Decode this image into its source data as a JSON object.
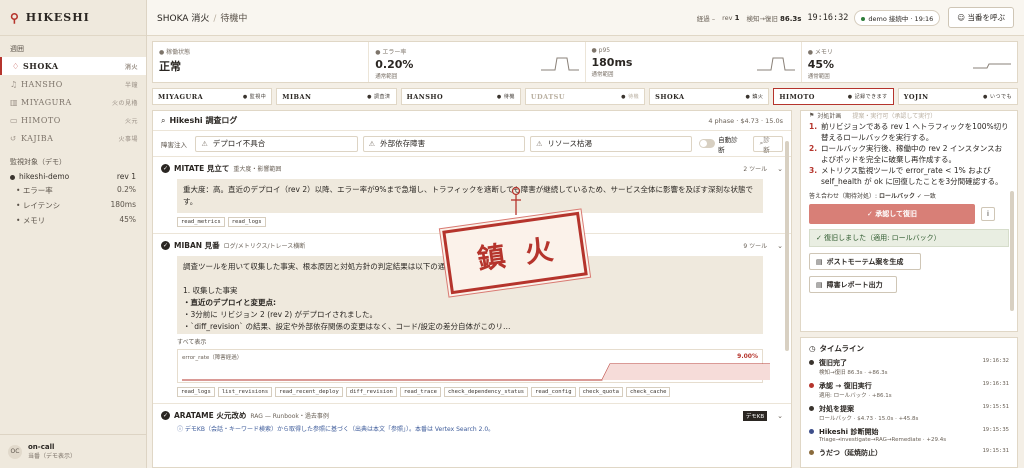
{
  "brand": {
    "name": "HIKESHI"
  },
  "sidebar": {
    "section_label": "週囲",
    "items": [
      {
        "name": "SHOKA",
        "tag": "消火"
      },
      {
        "name": "HANSHO",
        "tag": "半鐘"
      },
      {
        "name": "MIYAGURA",
        "tag": "火の見櫓"
      },
      {
        "name": "HIMOTO",
        "tag": "火元"
      },
      {
        "name": "KAJIBA",
        "tag": "火事場"
      }
    ],
    "monitor_label": "監視対象（デモ）",
    "monitor": {
      "name": "hikeshi-demo",
      "value": "rev 1"
    },
    "monitor_sub": [
      {
        "name": "エラー率",
        "value": "0.2%"
      },
      {
        "name": "レイテンシ",
        "value": "180ms"
      },
      {
        "name": "メモリ",
        "value": "45%"
      }
    ],
    "footer": {
      "avatar": "OC",
      "title": "on-call",
      "sub": "当番（デモ表示）"
    }
  },
  "topbar": {
    "crumb1": "SHOKA 消火",
    "sep": "/",
    "crumb2": "待機中",
    "elapsed_label": "経過 –",
    "rev_label": "rev",
    "rev": "1",
    "restore_label": "検知→復旧",
    "restore": "86.3s",
    "clock": "19:16:32",
    "pill": "demo 接続中 · 19:16",
    "call_btn": "当番を呼ぶ"
  },
  "metrics": [
    {
      "label": "稼働状態",
      "value": "正常",
      "sub": ""
    },
    {
      "label": "エラー率",
      "value": "0.20%",
      "sub": "通常範囲"
    },
    {
      "label": "p95",
      "value": "180ms",
      "sub": "通常範囲"
    },
    {
      "label": "メモリ",
      "value": "45%",
      "sub": "通常範囲"
    }
  ],
  "stations": [
    {
      "name": "MIYAGURA",
      "status": "監視中"
    },
    {
      "name": "MIBAN",
      "status": "調査済"
    },
    {
      "name": "HANSHO",
      "status": "待機"
    },
    {
      "name": "UDATSU",
      "status": "待機"
    },
    {
      "name": "SHOKA",
      "status": "鎮火"
    },
    {
      "name": "HIMOTO",
      "status": "記録できます"
    },
    {
      "name": "YOJIN",
      "status": "いつでも"
    }
  ],
  "log": {
    "title": "Hikeshi 調査ログ",
    "meta": "4 phase · $4.73 · 15.0s",
    "inject_label": "障害注入",
    "inject": [
      "デプロイ不具合",
      "外部依存障害",
      "リソース枯渇"
    ],
    "auto": "自動診断",
    "diag": "診断",
    "phases": [
      {
        "name": "MITATE 見立て",
        "desc": "重大度・影響範囲",
        "tools": "2 ツール",
        "text": "重大度：高。直近のデプロイ（rev 2）以降、エラー率が9%まで急増し、トラフィックを遮断しても障害が継続しているため、サービス全体に影響を及ぼす深刻な状態です。",
        "chips": [
          "read_metrics",
          "read_logs"
        ]
      },
      {
        "name": "MIBAN 見番",
        "desc": "ログ/メトリクス/トレース横断",
        "tools": "9 ツール",
        "lines": [
          "調査ツールを用いて収集した事実、根本原因と対処方針の判定結果は以下の通りです。",
          "",
          "1. 収集した事実",
          "・直近のデプロイと変更点:",
          "・3分前に リビジョン 2 (rev 2) がデプロイされました。",
          "・`diff_revision` の結果、設定や外部依存関係の変更はなく、コード/設定の差分自体がこのリ…"
        ],
        "showall": "すべて表示",
        "chart_label": "error_rate（障害経過）",
        "chart_value": "9.00%",
        "chips": [
          "read_logs",
          "list_revisions",
          "read_recent_deploy",
          "diff_revision",
          "read_trace",
          "check_dependency_status",
          "read_config",
          "check_quota",
          "check_cache"
        ]
      },
      {
        "name": "ARATAME 火元改め",
        "desc": "RAG — Runbook・過去事例",
        "badge": "デモKB",
        "note": "デモKB（会話・キーワード検索）から取得した参照に基づく（出典は本文「参照」）。本番は Vertex Search 2.0。"
      }
    ]
  },
  "stamp": {
    "c1": "鎮",
    "c2": "火"
  },
  "plan": {
    "header": "対処計画",
    "header_dim": "提案・実行可（承認して実行）",
    "steps": [
      "前リビジョンである rev 1 へトラフィックを100%切り替えるロールバックを実行する。",
      "ロールバック実行後、稼働中の rev 2 インスタンスおよびポッドを完全に破棄し再作成する。",
      "メトリクス監視ツールで error_rate < 1% および self_health が ok に回復したことを3分間確認する。"
    ],
    "match_label": "答え合わせ（期待対処）:",
    "match_value": "ロールバック",
    "match_ok": "✓ 一致",
    "approve": "✓ 承認して復旧",
    "info": "i",
    "restored": "✓ 復旧しました（適用: ロールバック）",
    "btn_post": "ポストモーテム案を生成",
    "btn_report": "障害レポート出力"
  },
  "timeline": {
    "title": "タイムライン",
    "items": [
      {
        "t": "復旧完了",
        "s": "検知→復旧 86.3s · +86.3s",
        "time": "19:16:32",
        "c": "#3a342e"
      },
      {
        "t": "承認 → 復旧実行",
        "s": "適用: ロールバック · +86.1s",
        "time": "19:16:31",
        "c": "#b5342c"
      },
      {
        "t": "対処を提案",
        "s": "ロールバック · $4.73 · 15.0s · +45.8s",
        "time": "19:15:51",
        "c": "#3a342e"
      },
      {
        "t": "Hikeshi 診断開始",
        "s": "Triage→investigate→RAG→Remediate · +29.4s",
        "time": "19:15:35",
        "c": "#3d4e8a"
      },
      {
        "t": "うだつ（延焼防止）",
        "s": "",
        "time": "19:15:31",
        "c": "#8a6b3d"
      }
    ]
  },
  "colors": {
    "accent": "#b5342c",
    "bg": "#f4efe6"
  }
}
